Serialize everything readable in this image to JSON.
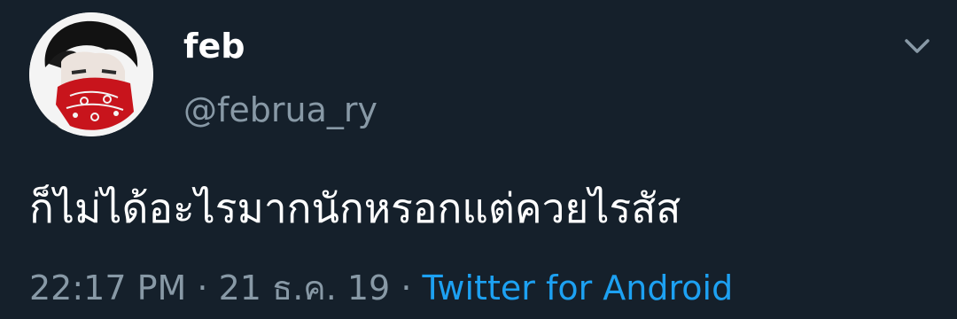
{
  "user": {
    "display_name": "feb",
    "handle": "@februa_ry"
  },
  "tweet": {
    "text": "ก็ไม่ได้อะไรมากนักหรอกแต่ควยไรสัส"
  },
  "meta": {
    "time": "22:17 PM",
    "separator": "·",
    "date": "21 ธ.ค. 19",
    "source": "Twitter for Android"
  },
  "icons": {
    "menu": "chevron-down-icon",
    "avatar": "avatar-photo"
  },
  "colors": {
    "background": "#15202b",
    "primary_text": "#ffffff",
    "secondary_text": "#8899a6",
    "link": "#1da1f2"
  }
}
